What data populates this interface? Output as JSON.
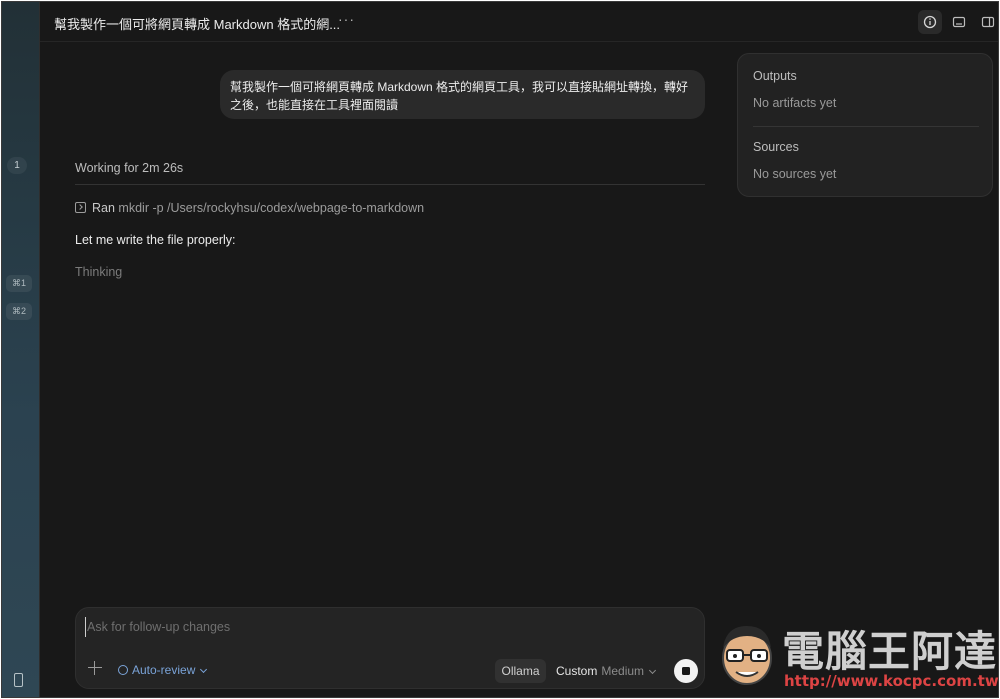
{
  "header": {
    "title": "幫我製作一個可將網頁轉成 Markdown 格式的網...",
    "more": "···"
  },
  "rail": {
    "badge": "1",
    "shortcuts": [
      "⌘1",
      "⌘2"
    ]
  },
  "conversation": {
    "user_message": "幫我製作一個可將網頁轉成 Markdown 格式的網頁工具，我可以直接貼網址轉換，轉好之後，也能直接在工具裡面閱讀",
    "working_status": "Working for 2m 26s",
    "ran_label": "Ran",
    "ran_command": "mkdir -p /Users/rockyhsu/codex/webpage-to-markdown",
    "assistant_message": "Let me write the file properly:",
    "thinking": "Thinking"
  },
  "side_panel": {
    "outputs_title": "Outputs",
    "outputs_empty": "No artifacts yet",
    "sources_title": "Sources",
    "sources_empty": "No sources yet"
  },
  "composer": {
    "placeholder": "Ask for follow-up changes",
    "auto_review": "Auto-review",
    "provider": "Ollama",
    "model": "Custom",
    "effort": "Medium"
  },
  "watermark": {
    "brand": "電腦王阿達",
    "url": "http://www.kocpc.com.tw"
  },
  "colors": {
    "background": "#181818",
    "bubble": "#2a2a2a",
    "accent": "#7aa3d8"
  }
}
